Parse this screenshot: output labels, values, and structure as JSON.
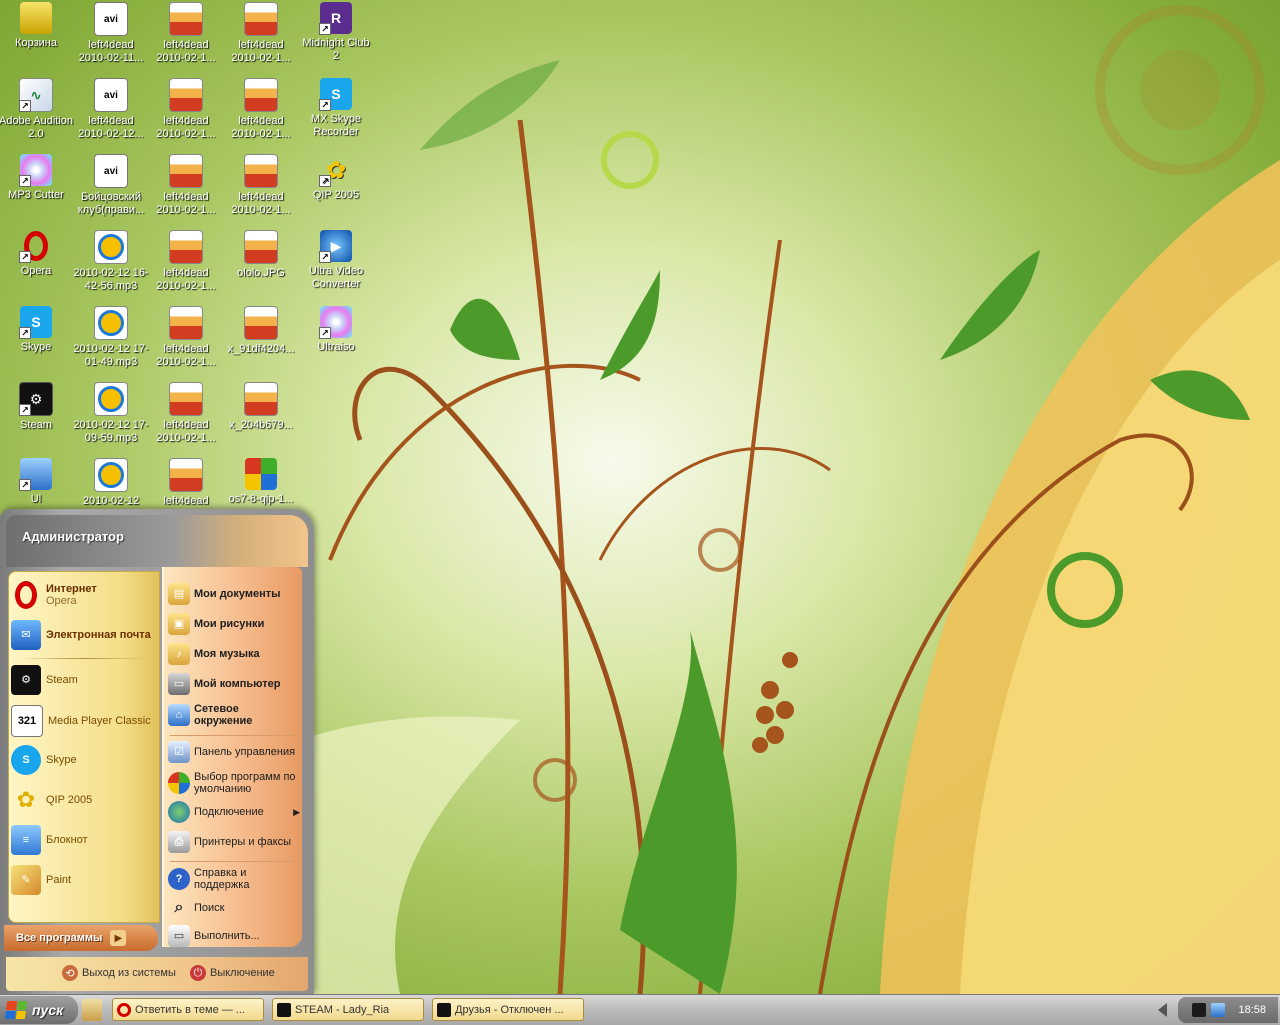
{
  "desktop": {
    "icons": [
      {
        "label": "Корзина",
        "icon": "recycle-bin-icon"
      },
      {
        "label": "left4dead 2010-02-11...",
        "icon": "avi-file-icon"
      },
      {
        "label": "left4dead 2010-02-1...",
        "icon": "image-file-icon"
      },
      {
        "label": "left4dead 2010-02-1...",
        "icon": "image-file-icon"
      },
      {
        "label": "Midnight Club 2",
        "icon": "rockstar-icon"
      },
      {
        "label": "Adobe Audition 2.0",
        "icon": "adobe-audition-icon"
      },
      {
        "label": "left4dead 2010-02-12...",
        "icon": "avi-file-icon"
      },
      {
        "label": "left4dead 2010-02-1...",
        "icon": "image-file-icon"
      },
      {
        "label": "left4dead 2010-02-1...",
        "icon": "image-file-icon"
      },
      {
        "label": "MX Skype Recorder",
        "icon": "skype-icon"
      },
      {
        "label": "MP3 Cutter",
        "icon": "cd-icon"
      },
      {
        "label": "Бойцовский клуб(прави...",
        "icon": "avi-file-icon"
      },
      {
        "label": "left4dead 2010-02-1...",
        "icon": "image-file-icon"
      },
      {
        "label": "left4dead 2010-02-1...",
        "icon": "image-file-icon"
      },
      {
        "label": "QIP 2005",
        "icon": "qip-icon"
      },
      {
        "label": "Opera",
        "icon": "opera-icon"
      },
      {
        "label": "2010-02-12 16-42-56.mp3",
        "icon": "mp3-file-icon"
      },
      {
        "label": "left4dead 2010-02-1...",
        "icon": "image-file-icon"
      },
      {
        "label": "ololo.JPG",
        "icon": "image-file-icon"
      },
      {
        "label": "Ultra Video Converter",
        "icon": "ultra-video-icon"
      },
      {
        "label": "Skype",
        "icon": "skype-icon"
      },
      {
        "label": "2010-02-12 17-01-49.mp3",
        "icon": "mp3-file-icon"
      },
      {
        "label": "left4dead 2010-02-1...",
        "icon": "image-file-icon"
      },
      {
        "label": "x_91df4204...",
        "icon": "image-file-icon"
      },
      {
        "label": "Ultraiso",
        "icon": "cd-icon"
      },
      {
        "label": "Steam",
        "icon": "steam-icon"
      },
      {
        "label": "2010-02-12 17-09-59.mp3",
        "icon": "mp3-file-icon"
      },
      {
        "label": "left4dead 2010-02-1...",
        "icon": "image-file-icon"
      },
      {
        "label": "x_204b679...",
        "icon": "image-file-icon"
      },
      {
        "label": "Ul",
        "icon": "network-icon"
      },
      {
        "label": "2010-02-12",
        "icon": "mp3-file-icon"
      },
      {
        "label": "left4dead",
        "icon": "image-file-icon"
      },
      {
        "label": "os7-8-qip-1...",
        "icon": "os-icon"
      }
    ]
  },
  "start_menu": {
    "user": "Администратор",
    "pinned": [
      {
        "title": "Интернет",
        "subtitle": "Opera"
      },
      {
        "title": "Электронная почта",
        "subtitle": ""
      }
    ],
    "recent": [
      "Steam",
      "Media Player Classic",
      "Skype",
      "QIP 2005",
      "Блокнот",
      "Paint"
    ],
    "all_programs": "Все программы",
    "places": [
      "Мои документы",
      "Мои рисунки",
      "Моя музыка",
      "Мой компьютер",
      "Сетевое окружение"
    ],
    "system": [
      "Панель управления",
      "Выбор программ по умолчанию",
      "Подключение",
      "Принтеры и факсы"
    ],
    "help": [
      "Справка и поддержка",
      "Поиск",
      "Выполнить..."
    ],
    "logoff": "Выход из системы",
    "shutdown": "Выключение"
  },
  "taskbar": {
    "start_label": "пуск",
    "tasks": [
      "Ответить в теме — ...",
      "STEAM - Lady_Ria",
      "Друзья - Отключен ..."
    ],
    "clock": "18:58"
  },
  "colors": {
    "accent_orange": "#e79a62",
    "menu_yellow": "#f4de88",
    "opera_red": "#d40000",
    "skype_blue": "#1aa6ec"
  }
}
